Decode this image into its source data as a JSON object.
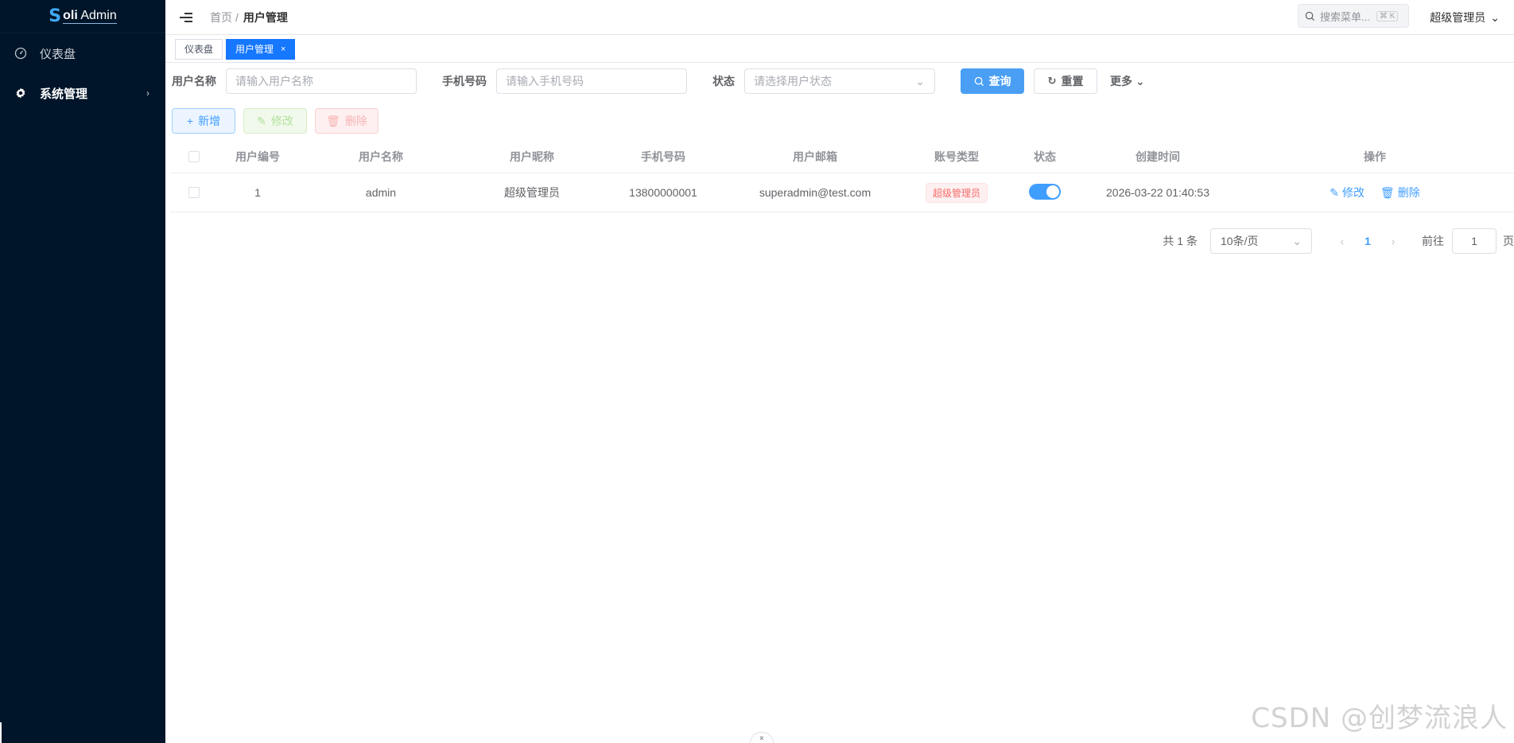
{
  "sidebar": {
    "logo_mark": "S",
    "logo_text_bold": "oli",
    "logo_text": "Admin",
    "items": [
      {
        "label": "仪表盘",
        "icon": "dashboard-icon"
      },
      {
        "label": "系统管理",
        "icon": "gear-icon"
      }
    ]
  },
  "header": {
    "breadcrumb_home": "首页",
    "breadcrumb_sep": "/",
    "breadcrumb_current": "用户管理",
    "search_placeholder": "搜索菜单...",
    "search_shortcut": "⌘ K",
    "user_name": "超级管理员"
  },
  "tabs": [
    {
      "label": "仪表盘",
      "active": false
    },
    {
      "label": "用户管理",
      "active": true
    }
  ],
  "search_form": {
    "username_label": "用户名称",
    "username_placeholder": "请输入用户名称",
    "phone_label": "手机号码",
    "phone_placeholder": "请输入手机号码",
    "status_label": "状态",
    "status_placeholder": "请选择用户状态",
    "query_label": "查询",
    "reset_label": "重置",
    "more_label": "更多"
  },
  "toolbar": {
    "add_label": "新增",
    "edit_label": "修改",
    "delete_label": "删除"
  },
  "table": {
    "columns": [
      "用户编号",
      "用户名称",
      "用户昵称",
      "手机号码",
      "用户邮箱",
      "账号类型",
      "状态",
      "创建时间",
      "操作"
    ],
    "rows": [
      {
        "id": "1",
        "username": "admin",
        "nickname": "超级管理员",
        "phone": "13800000001",
        "email": "superadmin@test.com",
        "type": "超级管理员",
        "status_on": true,
        "created": "2026-03-22 01:40:53",
        "op_edit": "修改",
        "op_delete": "删除"
      }
    ]
  },
  "pagination": {
    "total_text": "共 1 条",
    "page_size": "10条/页",
    "current_page": "1",
    "goto_label": "前往",
    "goto_value": "1",
    "page_suffix": "页"
  },
  "watermark": "CSDN @创梦流浪人",
  "colors": {
    "sidebar_bg": "#001529",
    "primary": "#409eff",
    "tab_active": "#1677ff",
    "danger": "#f56c6c"
  }
}
